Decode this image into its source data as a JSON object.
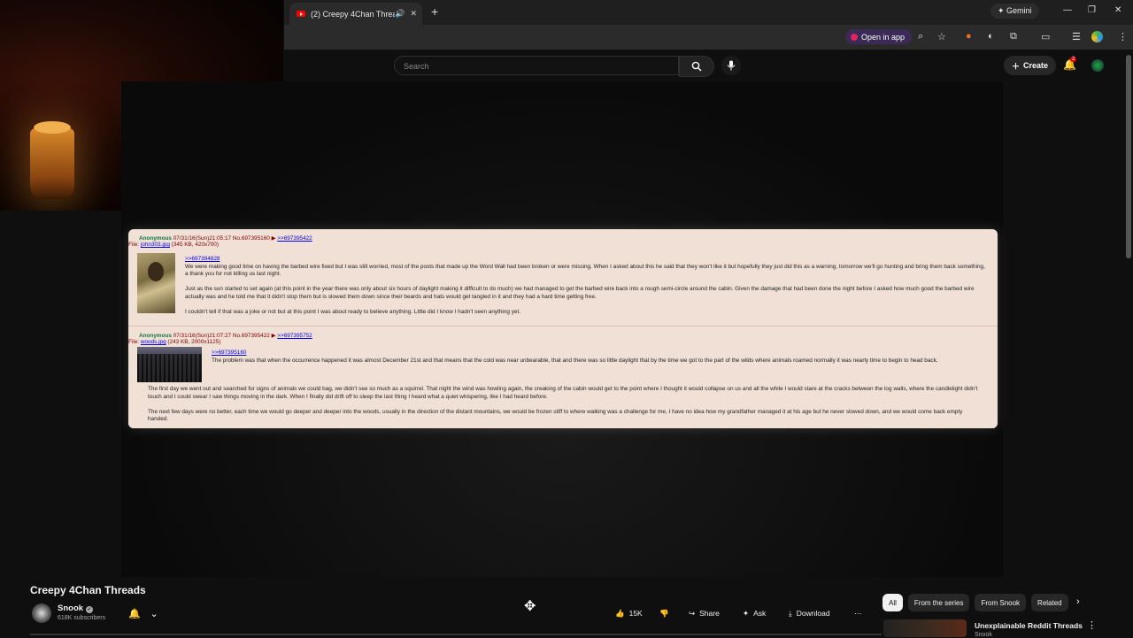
{
  "browser": {
    "tab_title": "(2) Creepy 4Chan Threads",
    "new_tab": "+",
    "gemini_label": "Gemini",
    "open_in_app": "Open in app"
  },
  "youtube": {
    "search_placeholder": "Search",
    "create_label": "Create",
    "notification_count": "2"
  },
  "thread": {
    "post1": {
      "name": "Anonymous",
      "meta": "07/31/16(Sun)21:05:17 No.697395160 ▶",
      "reply_link": ">>697395422",
      "file_prefix": "File:",
      "file_name": "john303.jpg",
      "file_info": "(345 KB, 420x700)",
      "quote": ">>697394828",
      "paragraphs": [
        "We were making good time on having the barbed wire fixed but I was still worried, most of the posts that made up the Word Wall had been broken or were missing. When I asked about this he said that they won't like it but hopefully they just did this as a warning, tomorrow we'll go hunting and bring them back something, a thank you for not killing us last night.",
        "Just as the sun started to set again (at this point in the year there was only about six hours of daylight making it difficult to do much) we had managed to get the barbed wire back into a rough semi-circle around the cabin. Given the damage that had been done the night before I asked how much good the barbed wire actually was and he told me that it didn't stop them but is slowed them down since their beards and hats would get tangled in it and they had a hard time getting free.",
        "I couldn't tell if that was a joke or not but at this point I was about ready to believe anything. Little did I know I hadn't seen anything yet."
      ]
    },
    "post2": {
      "name": "Anonymous",
      "meta": "07/31/16(Sun)21:07:27 No.697395422 ▶",
      "reply_link": ">>697395752",
      "file_prefix": "File:",
      "file_name": "woods.jpg",
      "file_info": "(243 KB, 2000x1125)",
      "quote": ">>697395160",
      "paragraph1": "The problem was that when the occurrence happened it was almost December 21st and that means that the cold was near unbearable, that and there was so little daylight that by the time we got to the part of the wilds where animals roamed normally it was nearly time to begin to head back.",
      "paragraphs_wide": [
        "The first day we went out and searched for signs of animals we could bag, we didn't see so much as a squirrel. That night the wind was howling again, the creaking of the cabin would get to the point where I thought it would collapse on us and all the while I would stare at the cracks between the log walls, where the candlelight didn't touch and I could swear I saw things moving in the dark. When I finally did drift off to sleep the last thing I heard what a quiet whispering, like I had heard before.",
        "The next few days were no better, each time we would go deeper and deeper into the woods, usually in the direction of the distant mountains, we would be frozen stiff to where walking was a challenge for me, I have no idea how my grandfather managed it at his age but he never slowed down, and we would come back empty handed."
      ]
    }
  },
  "video": {
    "title": "Creepy 4Chan Threads",
    "channel": "Snook",
    "subscribers": "618K subscribers",
    "like_count": "15K",
    "share_label": "Share",
    "ask_label": "Ask",
    "download_label": "Download"
  },
  "chips": [
    "All",
    "From the series",
    "From Snook",
    "Related"
  ],
  "recommended": {
    "title": "Unexplainable Reddit Threads",
    "channel": "Snook"
  }
}
